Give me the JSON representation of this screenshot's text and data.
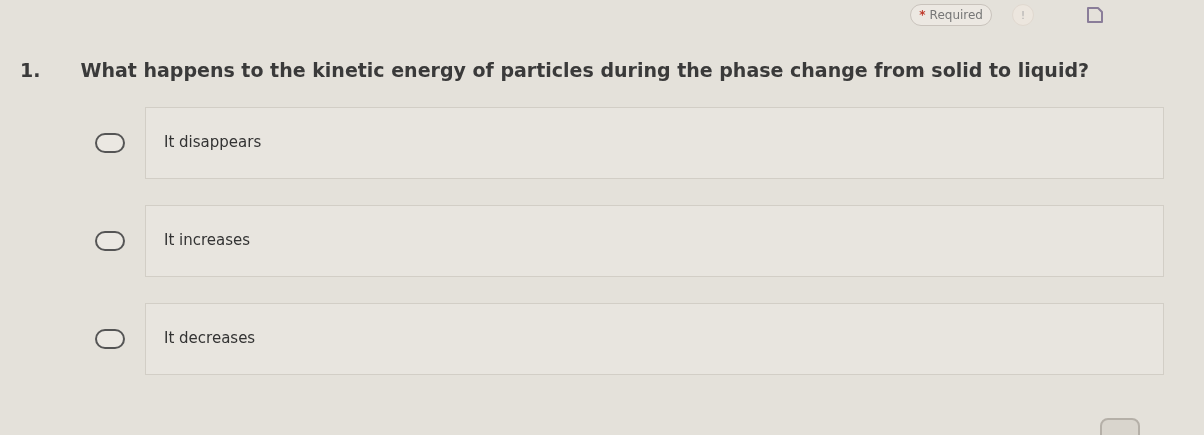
{
  "header": {
    "required_badge": {
      "mark": "*",
      "label": "Required"
    },
    "info_badge": "!"
  },
  "question": {
    "number": "1.",
    "text": "What happens to the kinetic energy of particles during the phase change from solid to liquid?"
  },
  "options": [
    {
      "label": "It disappears",
      "selected": false
    },
    {
      "label": "It increases",
      "selected": false
    },
    {
      "label": "It decreases",
      "selected": false
    }
  ]
}
